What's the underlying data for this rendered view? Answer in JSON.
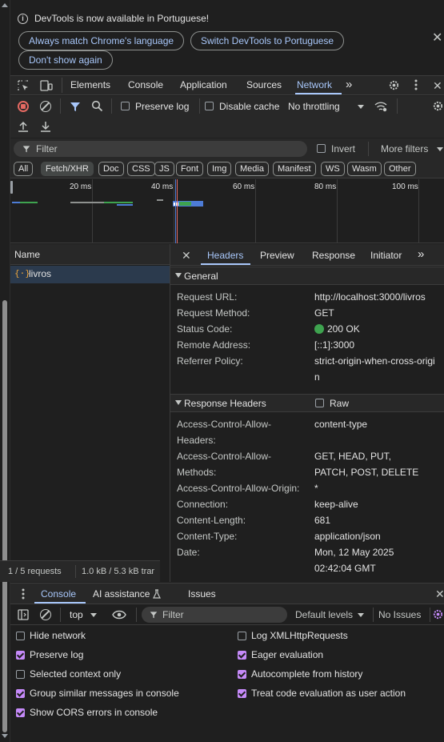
{
  "infobar": {
    "message": "DevTools is now available in Portuguese!",
    "btn_match": "Always match Chrome's language",
    "btn_switch": "Switch DevTools to Portuguese",
    "btn_dont_show": "Don't show again"
  },
  "tabs": {
    "elements": "Elements",
    "console": "Console",
    "application": "Application",
    "sources": "Sources",
    "network": "Network",
    "more": "»"
  },
  "toolbar": {
    "preserve_log": "Preserve log",
    "disable_cache": "Disable cache",
    "throttling": "No throttling",
    "filter_placeholder": "Filter",
    "invert": "Invert",
    "more_filters": "More filters"
  },
  "type_filters": [
    "All",
    "Fetch/XHR",
    "Doc",
    "CSS",
    "JS",
    "Font",
    "Img",
    "Media",
    "Manifest",
    "WS",
    "Wasm",
    "Other"
  ],
  "overview_ticks": [
    "20 ms",
    "40 ms",
    "60 ms",
    "80 ms",
    "100 ms"
  ],
  "request_list": {
    "header": "Name",
    "rows": [
      "livros"
    ],
    "status_requests": "1 / 5 requests",
    "status_transfer": "1.0 kB / 5.3 kB trar"
  },
  "detail": {
    "tabs": [
      "Headers",
      "Preview",
      "Response",
      "Initiator"
    ],
    "general_title": "General",
    "general": [
      {
        "k": "Request URL:",
        "v": "http://localhost:3000/livros"
      },
      {
        "k": "Request Method:",
        "v": "GET"
      },
      {
        "k": "Status Code:",
        "v": "200 OK"
      },
      {
        "k": "Remote Address:",
        "v": "[::1]:3000"
      },
      {
        "k": "Referrer Policy:",
        "v": "strict-origin-when-cross-origi"
      },
      {
        "k": "",
        "v": "n"
      }
    ],
    "response_title": "Response Headers",
    "raw": "Raw",
    "response": [
      {
        "k": "Access-Control-Allow-",
        "v": "content-type"
      },
      {
        "k": "Headers:",
        "v": ""
      },
      {
        "k": "Access-Control-Allow-",
        "v": "GET, HEAD, PUT,"
      },
      {
        "k": "Methods:",
        "v": "PATCH, POST, DELETE"
      },
      {
        "k": "Access-Control-Allow-Origin:",
        "v": "*"
      },
      {
        "k": "Connection:",
        "v": "keep-alive"
      },
      {
        "k": "Content-Length:",
        "v": "681"
      },
      {
        "k": "Content-Type:",
        "v": "application/json"
      },
      {
        "k": "Date:",
        "v": "Mon, 12 May 2025"
      },
      {
        "k": "",
        "v": "02:42:04 GMT"
      }
    ],
    "status_color": "#3ea34f"
  },
  "drawer": {
    "tab_console": "Console",
    "tab_ai": "AI assistance",
    "tab_issues": "Issues",
    "context": "top",
    "filter_placeholder": "Filter",
    "levels": "Default levels",
    "no_issues": "No Issues"
  },
  "console_settings": {
    "left": [
      {
        "label": "Hide network",
        "checked": false
      },
      {
        "label": "Preserve log",
        "checked": true
      },
      {
        "label": "Selected context only",
        "checked": false
      },
      {
        "label": "Group similar messages in console",
        "checked": true
      },
      {
        "label": "Show CORS errors in console",
        "checked": true
      }
    ],
    "right": [
      {
        "label": "Log XMLHttpRequests",
        "checked": false
      },
      {
        "label": "Eager evaluation",
        "checked": true
      },
      {
        "label": "Autocomplete from history",
        "checked": true
      },
      {
        "label": "Treat code evaluation as user action",
        "checked": true
      }
    ]
  },
  "colors": {
    "accent": "#a8c7fa",
    "checkbox": "#c58af9",
    "record": "#e46962",
    "selected_row": "#2b3a4d"
  }
}
